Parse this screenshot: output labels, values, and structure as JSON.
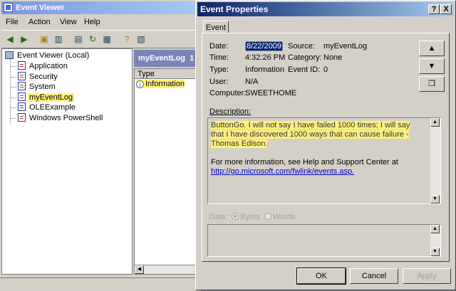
{
  "event_viewer": {
    "title": "Event Viewer",
    "menu": [
      "File",
      "Action",
      "View",
      "Help"
    ],
    "tree": {
      "root": "Event Viewer (Local)",
      "items": [
        "Application",
        "Security",
        "System",
        "myEventLog",
        "OLEExample",
        "Windows PowerShell"
      ],
      "selected": "myEventLog"
    },
    "list": {
      "title": "myEventLog",
      "title_suffix": "1",
      "columns": [
        "Type"
      ],
      "rows": [
        {
          "type": "Information"
        }
      ]
    }
  },
  "dialog": {
    "title": "Event Properties",
    "help_btn": "?",
    "close_btn": "X",
    "tab": "Event",
    "fields": {
      "date_label": "Date:",
      "date": "8/22/2009",
      "source_label": "Source:",
      "source": "myEventLog",
      "time_label": "Time:",
      "time": "4:32:26 PM",
      "category_label": "Category:",
      "category": "None",
      "type_label": "Type:",
      "type": "Information",
      "event_id_label": "Event ID:",
      "event_id": "0",
      "user_label": "User:",
      "user": "N/A",
      "computer_label": "Computer:",
      "computer": "SWEETHOME"
    },
    "description_label": "Description:",
    "description": "ButtonGo. I will not say I have failed 1000 times; I will say that I have discovered 1000 ways that can cause failure - Thomas Edison.",
    "more_info": "For more information, see Help and Support Center at",
    "link": "http://go.microsoft.com/fwlink/events.asp.",
    "data_label": "Data:",
    "bytes_label": "Bytes",
    "words_label": "Words",
    "buttons": {
      "ok": "OK",
      "cancel": "Cancel",
      "apply": "Apply"
    },
    "nav": {
      "up": "▲",
      "down": "▼"
    }
  }
}
